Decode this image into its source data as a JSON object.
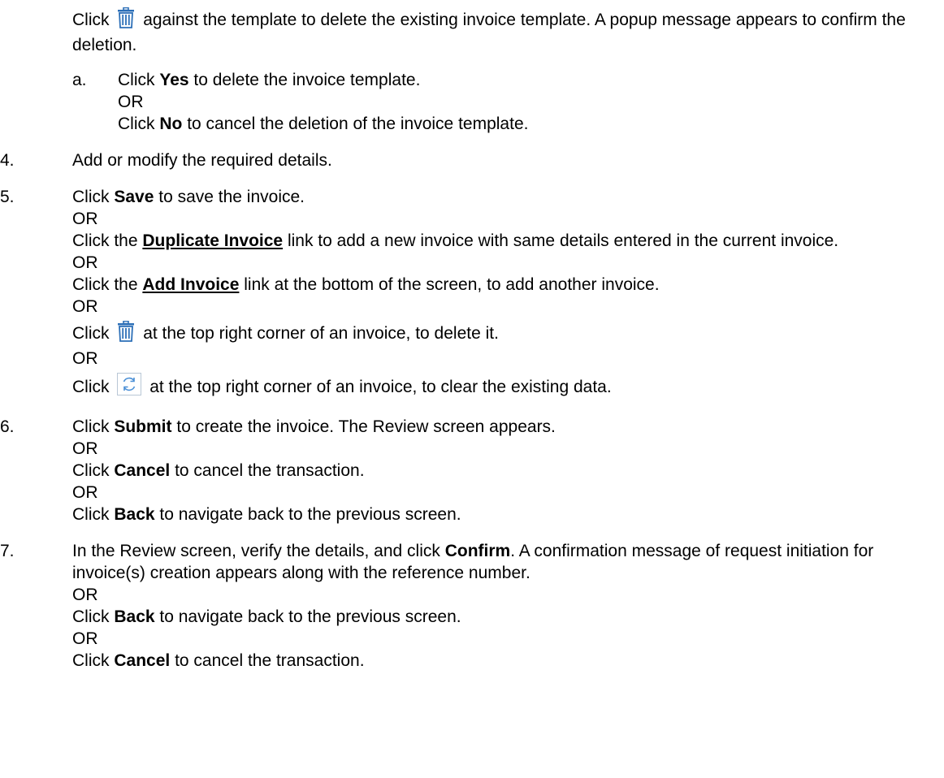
{
  "intro": {
    "click": "Click",
    "text": "against the template to delete the existing invoice template. A popup message appears to confirm the deletion.",
    "icon": "trash-icon"
  },
  "step_a": {
    "num": "a.",
    "p1_pre": "Click",
    "p1_bold": "Yes",
    "p1_post": "to delete the invoice template.",
    "or": "OR",
    "p2_pre": "Click",
    "p2_bold": "No",
    "p2_post": "to cancel the deletion of the invoice template."
  },
  "step4": {
    "num": "4.",
    "text": "Add or modify the required details."
  },
  "step5": {
    "num": "5.",
    "p1_pre": "Click",
    "p1_bold": "Save",
    "p1_post": "to save the invoice.",
    "or1": "OR",
    "p2_pre": "Click the",
    "p2_link": "Duplicate Invoice",
    "p2_post": "link to add a new invoice with same details entered in the current invoice.",
    "or2": "OR",
    "p3_pre": "Click the",
    "p3_link": "Add Invoice",
    "p3_post": "link at the bottom of the screen, to add another invoice.",
    "or3": "OR",
    "p4_pre": "Click",
    "p4_post": "at the top right corner of an invoice, to delete it.",
    "or4": "OR",
    "p5_pre": "Click",
    "p5_post": "at the top right corner of an invoice, to clear the existing data."
  },
  "step6": {
    "num": "6.",
    "p1_pre": "Click",
    "p1_bold": "Submit",
    "p1_post": "to create the invoice. The Review screen appears.",
    "or1": "OR",
    "p2_pre": "Click",
    "p2_bold": "Cancel",
    "p2_post": "to cancel the transaction.",
    "or2": "OR",
    "p3_pre": "Click",
    "p3_bold": "Back",
    "p3_post": "to navigate back to the previous screen."
  },
  "step7": {
    "num": "7.",
    "p1_pre": "In the Review screen, verify the details, and click",
    "p1_bold": "Confirm",
    "p1_post": ". A confirmation message of request initiation for invoice(s) creation appears along with the reference number.",
    "or1": "OR",
    "p2_pre": "Click",
    "p2_bold": "Back",
    "p2_post": "to navigate back to the previous screen.",
    "or2": "OR",
    "p3_pre": "Click",
    "p3_bold": "Cancel",
    "p3_post": "to cancel the transaction."
  },
  "colors": {
    "trash_icon": "#2c6fb7",
    "refresh_icon": "#4a8fd6",
    "refresh_border": "#b9c7d6"
  }
}
